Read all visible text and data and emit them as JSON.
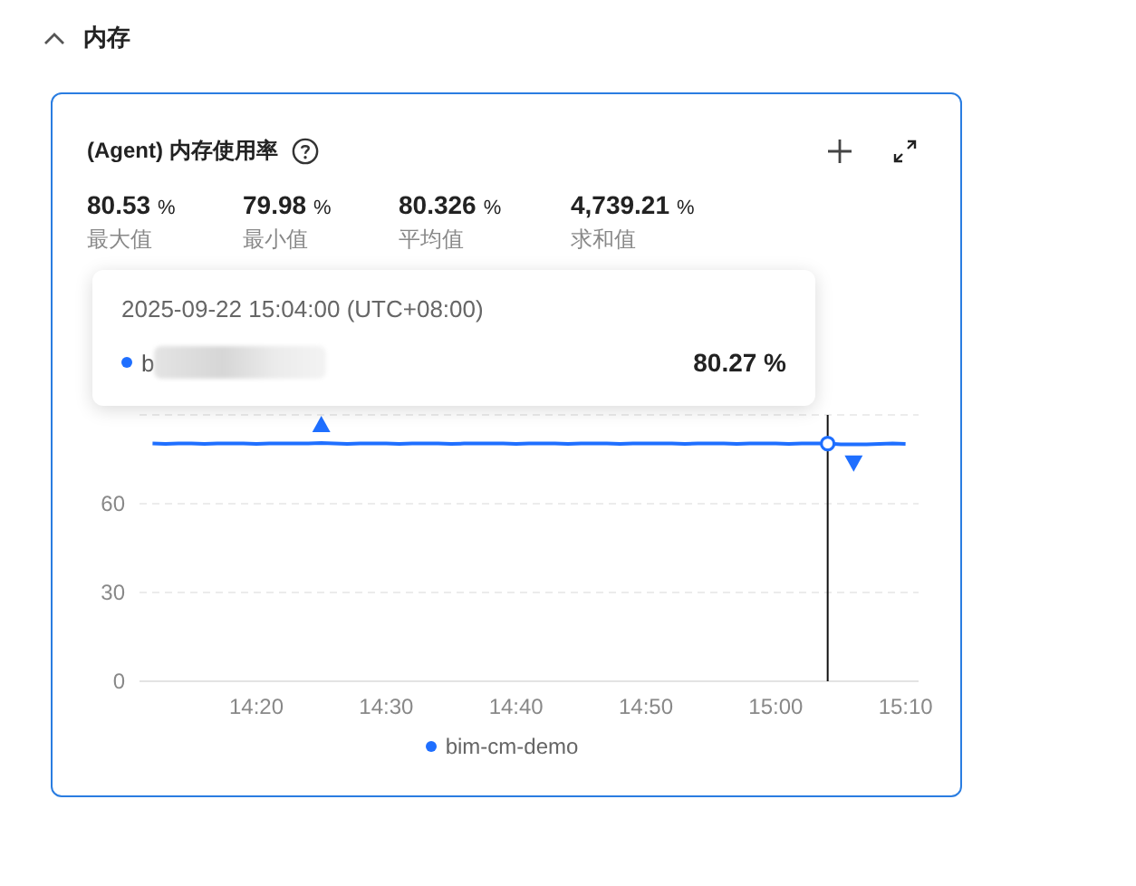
{
  "section": {
    "title": "内存",
    "expanded": true
  },
  "card": {
    "title": "(Agent) 内存使用率",
    "stats": [
      {
        "value": "80.53",
        "unit": "%",
        "label": "最大值"
      },
      {
        "value": "79.98",
        "unit": "%",
        "label": "最小值"
      },
      {
        "value": "80.326",
        "unit": "%",
        "label": "平均值"
      },
      {
        "value": "4,739.21",
        "unit": "%",
        "label": "求和值"
      }
    ],
    "tooltip": {
      "time": "2025-09-22 15:04:00 (UTC+08:00)",
      "series_visible": "b",
      "value": "80.27 %"
    },
    "chart_data": {
      "type": "line",
      "categories": [
        null,
        null,
        null,
        null,
        null,
        null,
        null,
        null,
        "14:20",
        null,
        null,
        null,
        null,
        null,
        null,
        null,
        null,
        null,
        "14:30",
        null,
        null,
        null,
        null,
        null,
        null,
        null,
        null,
        null,
        "14:40",
        null,
        null,
        null,
        null,
        null,
        null,
        null,
        null,
        null,
        "14:50",
        null,
        null,
        null,
        null,
        null,
        null,
        null,
        null,
        null,
        "15:00",
        null,
        null,
        null,
        null,
        null,
        null,
        null,
        null,
        null,
        "15:10"
      ],
      "series": [
        {
          "name": "bim-cm-demo",
          "color": "#1f6fff",
          "values": [
            80.3,
            80.2,
            80.3,
            80.4,
            80.2,
            80.3,
            80.4,
            80.3,
            80.2,
            80.3,
            80.4,
            80.3,
            80.4,
            80.5,
            80.3,
            80.2,
            80.3,
            80.4,
            80.3,
            80.2,
            80.3,
            80.4,
            80.3,
            80.2,
            80.3,
            80.4,
            80.3,
            80.3,
            80.2,
            80.3,
            80.4,
            80.3,
            80.2,
            80.3,
            80.4,
            80.3,
            80.2,
            80.3,
            80.4,
            80.3,
            80.3,
            80.2,
            80.3,
            80.4,
            80.3,
            80.2,
            80.3,
            80.4,
            80.3,
            80.2,
            80.3,
            80.3,
            80.3,
            80.1,
            80.0,
            80.1,
            80.2,
            80.3,
            80.2
          ]
        }
      ],
      "yticks": [
        0,
        30,
        60
      ],
      "ylim": [
        0,
        90
      ]
    }
  }
}
